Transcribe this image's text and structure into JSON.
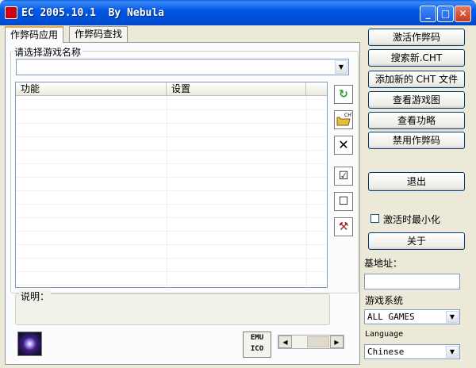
{
  "window": {
    "title": "EC 2005.10.1  By Nebula",
    "controls": {
      "minimize": "_",
      "maximize": "□",
      "close": "✕"
    }
  },
  "tabs": [
    {
      "label": "作弊码应用",
      "active": true
    },
    {
      "label": "作弊码查找",
      "active": false
    }
  ],
  "game_select": {
    "label": "请选择游戏名称",
    "value": "",
    "arrow_icon": "chevron-down-icon"
  },
  "list": {
    "columns": [
      "功能",
      "设置"
    ],
    "rows": []
  },
  "tools": [
    {
      "name": "refresh",
      "glyph": "↻"
    },
    {
      "name": "open-cht",
      "glyph": "📂"
    },
    {
      "name": "delete",
      "glyph": "✕"
    },
    {
      "name": "check-all",
      "glyph": "☑"
    },
    {
      "name": "uncheck-all",
      "glyph": "☐"
    },
    {
      "name": "tools",
      "glyph": "⚒"
    }
  ],
  "description": {
    "label": "说明："
  },
  "buttons": {
    "activate": "激活作弊码",
    "search_cht": "搜索新.CHT",
    "add_cht": "添加新的 CHT 文件",
    "view_map": "查看游戏图",
    "view_guide": "查看功略",
    "disable": "禁用作弊码",
    "exit": "退出",
    "about": "关于"
  },
  "options": {
    "minimize_on_activate": {
      "label": "激活时最小化",
      "checked": false
    }
  },
  "base_address": {
    "label": "基地址：",
    "value": ""
  },
  "game_system": {
    "label": "游戏系统",
    "value": "ALL GAMES"
  },
  "language": {
    "label": "Language",
    "value": "Chinese"
  },
  "emu_icon": {
    "line1": "EMU",
    "line2": "ICO"
  }
}
